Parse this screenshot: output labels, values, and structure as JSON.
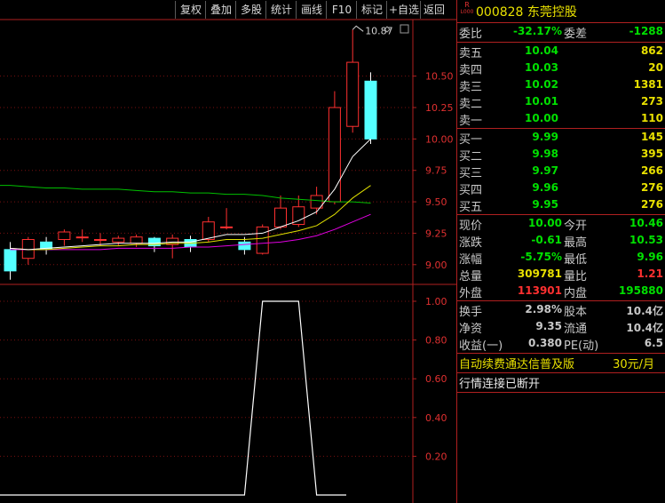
{
  "toolbar": [
    "复权",
    "叠加",
    "多股",
    "统计",
    "画线",
    "F10",
    "标记",
    "+自选",
    "返回"
  ],
  "stock": {
    "badge_top": "R",
    "badge_bottom": "L000",
    "code": "000828",
    "name": "东莞控股"
  },
  "weibi": {
    "label": "委比",
    "value": "-32.17%",
    "label2": "委差",
    "value2": "-1288"
  },
  "sell": [
    {
      "label": "卖五",
      "price": "10.04",
      "vol": "862"
    },
    {
      "label": "卖四",
      "price": "10.03",
      "vol": "20"
    },
    {
      "label": "卖三",
      "price": "10.02",
      "vol": "1381"
    },
    {
      "label": "卖二",
      "price": "10.01",
      "vol": "273"
    },
    {
      "label": "卖一",
      "price": "10.00",
      "vol": "110"
    }
  ],
  "buy": [
    {
      "label": "买一",
      "price": "9.99",
      "vol": "145"
    },
    {
      "label": "买二",
      "price": "9.98",
      "vol": "395"
    },
    {
      "label": "买三",
      "price": "9.97",
      "vol": "266"
    },
    {
      "label": "买四",
      "price": "9.96",
      "vol": "276"
    },
    {
      "label": "买五",
      "price": "9.95",
      "vol": "276"
    }
  ],
  "quote": [
    {
      "l1": "现价",
      "v1": "10.00",
      "l2": "今开",
      "v2": "10.46",
      "c1": "green",
      "c2": "green"
    },
    {
      "l1": "涨跌",
      "v1": "-0.61",
      "l2": "最高",
      "v2": "10.53",
      "c1": "green",
      "c2": "green"
    },
    {
      "l1": "涨幅",
      "v1": "-5.75%",
      "l2": "最低",
      "v2": "9.96",
      "c1": "green",
      "c2": "green"
    },
    {
      "l1": "总量",
      "v1": "309781",
      "l2": "量比",
      "v2": "1.21",
      "c1": "yellow",
      "c2": "red"
    },
    {
      "l1": "外盘",
      "v1": "113901",
      "l2": "内盘",
      "v2": "195880",
      "c1": "red",
      "c2": "green"
    }
  ],
  "fin": [
    {
      "l1": "换手",
      "v1": "2.98%",
      "l2": "股本",
      "v2": "10.4亿"
    },
    {
      "l1": "净资",
      "v1": "9.35",
      "l2": "流通",
      "v2": "10.4亿"
    },
    {
      "l1": "收益(一)",
      "v1": "0.380",
      "l2": "PE(动)",
      "v2": "6.5"
    }
  ],
  "ad": {
    "text": "自动续费通达信普及版",
    "price": "30元/月"
  },
  "status": "行情连接已断开",
  "chart_data": [
    {
      "type": "candlestick",
      "y_ticks": [
        "10.50",
        "10.25",
        "10.00",
        "9.75",
        "9.50",
        "9.25",
        "9.00"
      ],
      "high_annotation": "10.87",
      "ylim": [
        8.85,
        10.95
      ],
      "candles": [
        {
          "o": 9.12,
          "c": 8.95,
          "h": 9.18,
          "l": 8.88
        },
        {
          "o": 9.05,
          "c": 9.2,
          "h": 9.22,
          "l": 9.0
        },
        {
          "o": 9.18,
          "c": 9.12,
          "h": 9.22,
          "l": 9.08
        },
        {
          "o": 9.2,
          "c": 9.26,
          "h": 9.28,
          "l": 9.15
        },
        {
          "o": 9.22,
          "c": 9.22,
          "h": 9.28,
          "l": 9.18
        },
        {
          "o": 9.2,
          "c": 9.2,
          "h": 9.25,
          "l": 9.15
        },
        {
          "o": 9.18,
          "c": 9.21,
          "h": 9.23,
          "l": 9.15
        },
        {
          "o": 9.17,
          "c": 9.22,
          "h": 9.24,
          "l": 9.14
        },
        {
          "o": 9.21,
          "c": 9.15,
          "h": 9.22,
          "l": 9.1
        },
        {
          "o": 9.16,
          "c": 9.21,
          "h": 9.24,
          "l": 9.05
        },
        {
          "o": 9.2,
          "c": 9.14,
          "h": 9.23,
          "l": 9.1
        },
        {
          "o": 9.2,
          "c": 9.34,
          "h": 9.38,
          "l": 9.18
        },
        {
          "o": 9.3,
          "c": 9.3,
          "h": 9.45,
          "l": 9.28
        },
        {
          "o": 9.18,
          "c": 9.12,
          "h": 9.22,
          "l": 9.08
        },
        {
          "o": 9.09,
          "c": 9.3,
          "h": 9.32,
          "l": 9.08
        },
        {
          "o": 9.3,
          "c": 9.45,
          "h": 9.55,
          "l": 9.28
        },
        {
          "o": 9.32,
          "c": 9.46,
          "h": 9.55,
          "l": 9.3
        },
        {
          "o": 9.45,
          "c": 9.55,
          "h": 9.62,
          "l": 9.4
        },
        {
          "o": 9.5,
          "c": 10.25,
          "h": 10.38,
          "l": 9.48
        },
        {
          "o": 10.1,
          "c": 10.61,
          "h": 10.87,
          "l": 10.05
        },
        {
          "o": 10.46,
          "c": 10.0,
          "h": 10.53,
          "l": 9.96
        }
      ],
      "ma_green": [
        9.63,
        9.62,
        9.61,
        9.61,
        9.6,
        9.6,
        9.6,
        9.59,
        9.58,
        9.58,
        9.57,
        9.57,
        9.56,
        9.56,
        9.55,
        9.53,
        9.52,
        9.51,
        9.5,
        9.5,
        9.49
      ],
      "ma_white": [
        9.13,
        9.12,
        9.13,
        9.14,
        9.15,
        9.16,
        9.17,
        9.17,
        9.17,
        9.18,
        9.18,
        9.21,
        9.24,
        9.24,
        9.25,
        9.3,
        9.35,
        9.42,
        9.6,
        9.86,
        10.0
      ],
      "ma_yellow": [
        9.13,
        9.12,
        9.12,
        9.13,
        9.14,
        9.15,
        9.15,
        9.16,
        9.16,
        9.17,
        9.17,
        9.18,
        9.2,
        9.2,
        9.21,
        9.24,
        9.27,
        9.31,
        9.4,
        9.53,
        9.63
      ],
      "ma_magenta": [
        9.12,
        9.12,
        9.12,
        9.12,
        9.12,
        9.12,
        9.13,
        9.13,
        9.13,
        9.13,
        9.14,
        9.14,
        9.15,
        9.16,
        9.17,
        9.18,
        9.2,
        9.23,
        9.28,
        9.34,
        9.4
      ]
    },
    {
      "type": "line",
      "y_ticks": [
        "1.00",
        "0.80",
        "0.60",
        "0.40",
        "0.20"
      ],
      "ylim": [
        0,
        1
      ],
      "x": [
        0,
        13,
        14,
        16,
        17,
        20
      ],
      "y": [
        0,
        0,
        1,
        1,
        0,
        0
      ]
    }
  ]
}
